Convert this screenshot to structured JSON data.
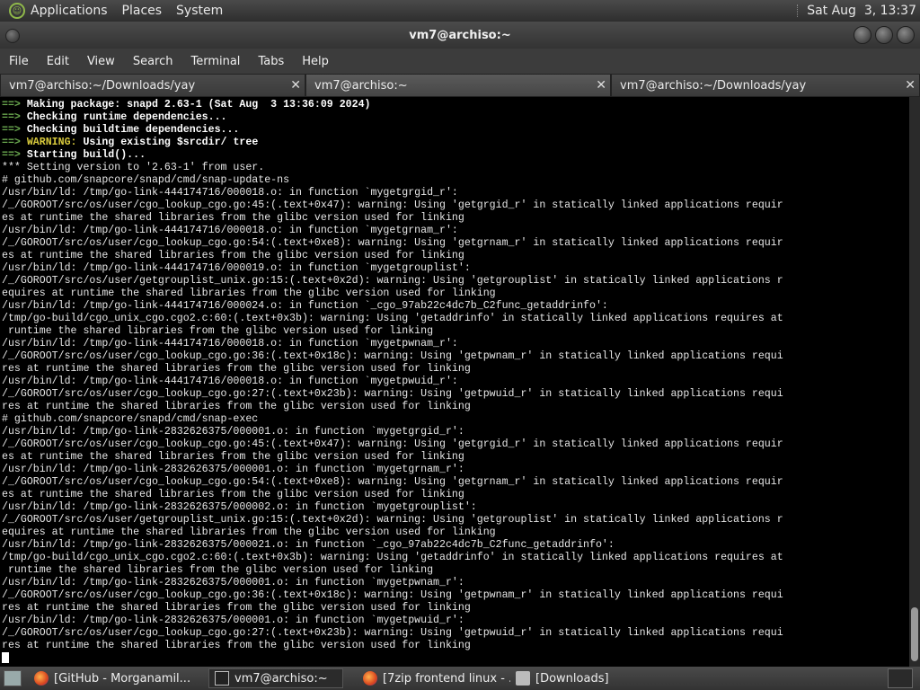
{
  "top_panel": {
    "menus": [
      "Applications",
      "Places",
      "System"
    ],
    "clock": "Sat Aug  3, 13:37"
  },
  "window": {
    "title": "vm7@archiso:~"
  },
  "menubar": [
    "File",
    "Edit",
    "View",
    "Search",
    "Terminal",
    "Tabs",
    "Help"
  ],
  "tabs": [
    {
      "label": "vm7@archiso:~/Downloads/yay"
    },
    {
      "label": "vm7@archiso:~"
    },
    {
      "label": "vm7@archiso:~/Downloads/yay"
    }
  ],
  "terminal": {
    "header": [
      {
        "arrow": "==>",
        "text": "Making package: snapd 2.63-1 (Sat Aug  3 13:36:09 2024)"
      },
      {
        "arrow": "==>",
        "text": "Checking runtime dependencies..."
      },
      {
        "arrow": "==>",
        "text": "Checking buildtime dependencies..."
      },
      {
        "arrow": "==>",
        "warning": "WARNING:",
        "text": "Using existing $srcdir/ tree"
      },
      {
        "arrow": "==>",
        "text": "Starting build()..."
      }
    ],
    "lines": [
      "*** Setting version to '2.63-1' from user.",
      "# github.com/snapcore/snapd/cmd/snap-update-ns",
      "/usr/bin/ld: /tmp/go-link-444174716/000018.o: in function `mygetgrgid_r':",
      "/_/GOROOT/src/os/user/cgo_lookup_cgo.go:45:(.text+0x47): warning: Using 'getgrgid_r' in statically linked applications requir",
      "es at runtime the shared libraries from the glibc version used for linking",
      "/usr/bin/ld: /tmp/go-link-444174716/000018.o: in function `mygetgrnam_r':",
      "/_/GOROOT/src/os/user/cgo_lookup_cgo.go:54:(.text+0xe8): warning: Using 'getgrnam_r' in statically linked applications requir",
      "es at runtime the shared libraries from the glibc version used for linking",
      "/usr/bin/ld: /tmp/go-link-444174716/000019.o: in function `mygetgrouplist':",
      "/_/GOROOT/src/os/user/getgrouplist_unix.go:15:(.text+0x2d): warning: Using 'getgrouplist' in statically linked applications r",
      "equires at runtime the shared libraries from the glibc version used for linking",
      "/usr/bin/ld: /tmp/go-link-444174716/000024.o: in function `_cgo_97ab22c4dc7b_C2func_getaddrinfo':",
      "/tmp/go-build/cgo_unix_cgo.cgo2.c:60:(.text+0x3b): warning: Using 'getaddrinfo' in statically linked applications requires at",
      " runtime the shared libraries from the glibc version used for linking",
      "/usr/bin/ld: /tmp/go-link-444174716/000018.o: in function `mygetpwnam_r':",
      "/_/GOROOT/src/os/user/cgo_lookup_cgo.go:36:(.text+0x18c): warning: Using 'getpwnam_r' in statically linked applications requi",
      "res at runtime the shared libraries from the glibc version used for linking",
      "/usr/bin/ld: /tmp/go-link-444174716/000018.o: in function `mygetpwuid_r':",
      "/_/GOROOT/src/os/user/cgo_lookup_cgo.go:27:(.text+0x23b): warning: Using 'getpwuid_r' in statically linked applications requi",
      "res at runtime the shared libraries from the glibc version used for linking",
      "# github.com/snapcore/snapd/cmd/snap-exec",
      "/usr/bin/ld: /tmp/go-link-2832626375/000001.o: in function `mygetgrgid_r':",
      "/_/GOROOT/src/os/user/cgo_lookup_cgo.go:45:(.text+0x47): warning: Using 'getgrgid_r' in statically linked applications requir",
      "es at runtime the shared libraries from the glibc version used for linking",
      "/usr/bin/ld: /tmp/go-link-2832626375/000001.o: in function `mygetgrnam_r':",
      "/_/GOROOT/src/os/user/cgo_lookup_cgo.go:54:(.text+0xe8): warning: Using 'getgrnam_r' in statically linked applications requir",
      "es at runtime the shared libraries from the glibc version used for linking",
      "/usr/bin/ld: /tmp/go-link-2832626375/000002.o: in function `mygetgrouplist':",
      "/_/GOROOT/src/os/user/getgrouplist_unix.go:15:(.text+0x2d): warning: Using 'getgrouplist' in statically linked applications r",
      "equires at runtime the shared libraries from the glibc version used for linking",
      "/usr/bin/ld: /tmp/go-link-2832626375/000021.o: in function `_cgo_97ab22c4dc7b_C2func_getaddrinfo':",
      "/tmp/go-build/cgo_unix_cgo.cgo2.c:60:(.text+0x3b): warning: Using 'getaddrinfo' in statically linked applications requires at",
      " runtime the shared libraries from the glibc version used for linking",
      "/usr/bin/ld: /tmp/go-link-2832626375/000001.o: in function `mygetpwnam_r':",
      "/_/GOROOT/src/os/user/cgo_lookup_cgo.go:36:(.text+0x18c): warning: Using 'getpwnam_r' in statically linked applications requi",
      "res at runtime the shared libraries from the glibc version used for linking",
      "/usr/bin/ld: /tmp/go-link-2832626375/000001.o: in function `mygetpwuid_r':",
      "/_/GOROOT/src/os/user/cgo_lookup_cgo.go:27:(.text+0x23b): warning: Using 'getpwuid_r' in statically linked applications requi",
      "res at runtime the shared libraries from the glibc version used for linking"
    ]
  },
  "taskbar": [
    {
      "label": "[GitHub - Morganamil...",
      "icon": "firefox-icon"
    },
    {
      "label": "vm7@archiso:~",
      "icon": "terminal-icon"
    },
    {
      "label": "[7zip frontend linux - ...",
      "icon": "firefox-icon"
    },
    {
      "label": "[Downloads]",
      "icon": "folder-icon"
    }
  ],
  "colors": {
    "prompt_arrow": "#6aa84f",
    "warning": "#d7c93c",
    "terminal_bg": "#000000"
  }
}
